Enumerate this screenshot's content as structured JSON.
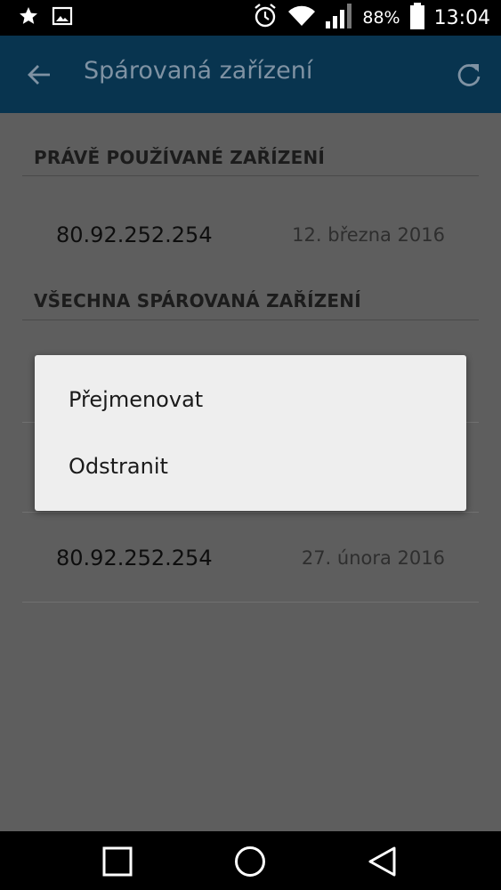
{
  "status_bar": {
    "battery_percent": "88%",
    "time": "13:04",
    "icons": [
      "star-icon",
      "image-icon",
      "alarm-icon",
      "wifi-icon",
      "signal-icon",
      "battery-icon"
    ]
  },
  "app_bar": {
    "title": "Spárovaná zařízení",
    "icons": [
      "back-arrow-icon",
      "refresh-icon"
    ]
  },
  "sections": {
    "current": {
      "header": "PRÁVĚ POUŽÍVANÉ ZAŘÍZENÍ",
      "device": {
        "ip": "80.92.252.254",
        "date": "12. března 2016"
      }
    },
    "all": {
      "header": "VŠECHNA SPÁROVANÁ ZAŘÍZENÍ",
      "devices": [
        {
          "ip": "80.92.252.254",
          "date": "27. února 2016"
        }
      ]
    }
  },
  "context_menu": {
    "items": [
      {
        "label": "Přejmenovat"
      },
      {
        "label": "Odstranit"
      }
    ]
  },
  "nav_bar": {
    "icons": [
      "recents-square-icon",
      "home-circle-icon",
      "back-triangle-icon"
    ]
  },
  "colors": {
    "app_bar": "#08344f",
    "scrim_background": "#5e5e5e",
    "menu_background": "#eeeeee"
  }
}
